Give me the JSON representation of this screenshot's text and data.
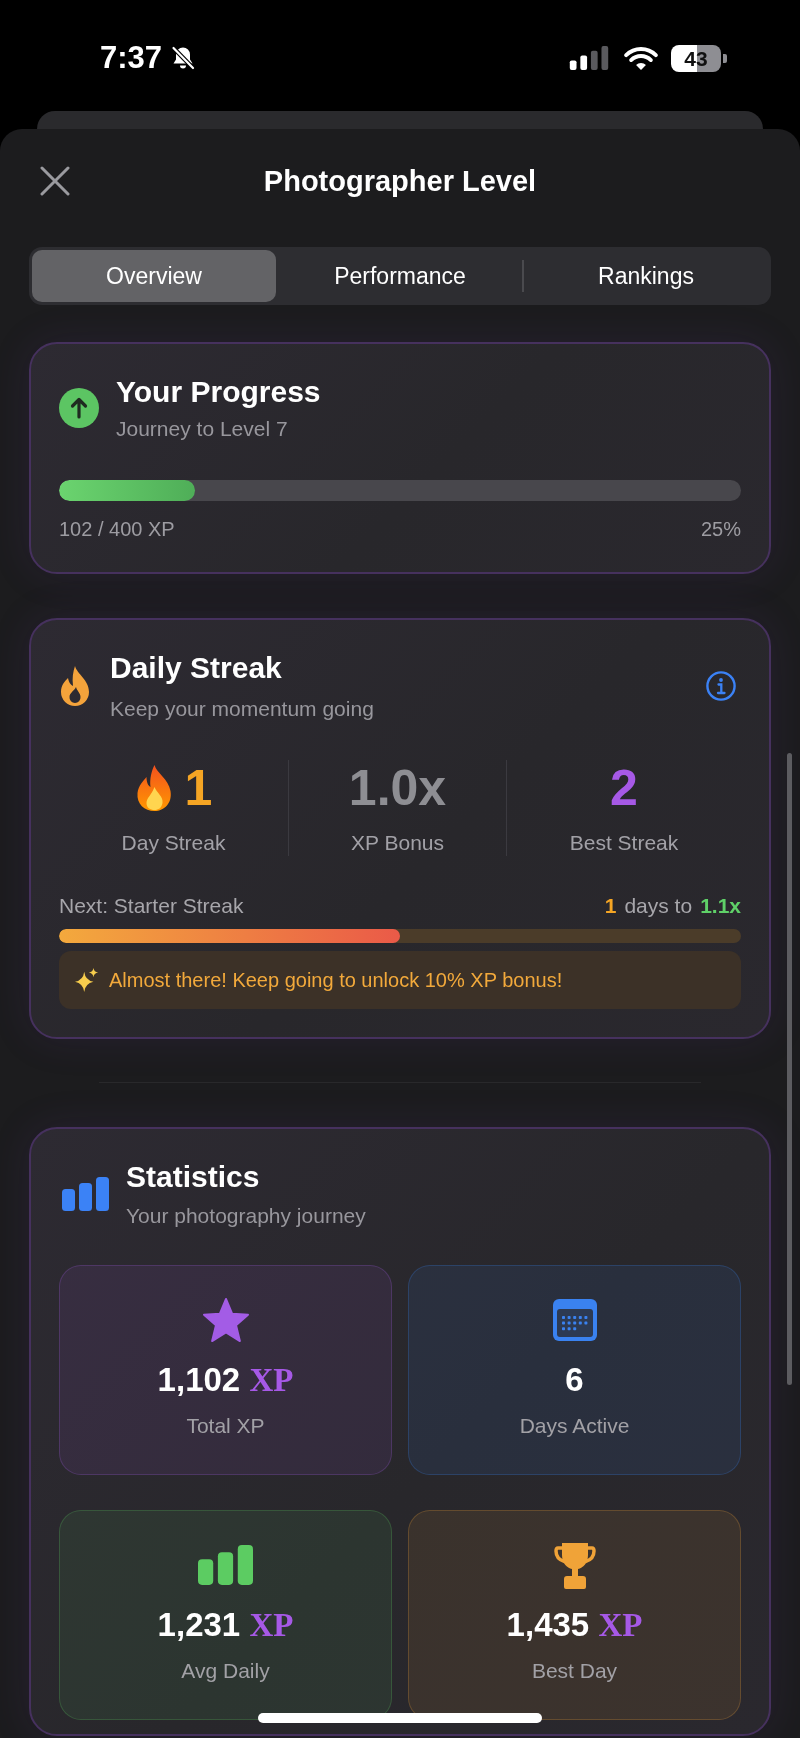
{
  "status_bar": {
    "time": "7:37",
    "battery": "43"
  },
  "header": {
    "title": "Photographer Level"
  },
  "tabs": [
    {
      "label": "Overview",
      "selected": true
    },
    {
      "label": "Performance",
      "selected": false
    },
    {
      "label": "Rankings",
      "selected": false
    }
  ],
  "progress": {
    "title": "Your Progress",
    "subtitle": "Journey to Level 7",
    "level": 0.2,
    "xp": "102 / 400 XP",
    "percent": "25%"
  },
  "streak": {
    "title": "Daily Streak",
    "subtitle": "Keep your momentum going",
    "stats": [
      {
        "value": "1",
        "label": "Day Streak",
        "color": "#f5a524"
      },
      {
        "value": "1.0x",
        "label": "XP Bonus",
        "color": "#8e8e93"
      },
      {
        "value": "2",
        "label": "Best Streak",
        "color": "#a659e6"
      }
    ],
    "next": "Next: Starter Streak",
    "days_left": "1",
    "days_text": "days to",
    "next_bonus": "1.1x",
    "level": 0.5,
    "message": "Almost there! Keep going to unlock 10% XP bonus!"
  },
  "statistics": {
    "title": "Statistics",
    "subtitle": "Your photography journey",
    "tiles": [
      {
        "value": "1,102",
        "unit": "XP",
        "label": "Total XP",
        "color": "#a35ce6"
      },
      {
        "value": "6",
        "label": "Days Active",
        "color": "#3a82f0"
      },
      {
        "value": "1,231",
        "unit": "XP",
        "label": "Avg Daily",
        "color": "#5ccc62"
      },
      {
        "value": "1,435",
        "unit": "XP",
        "label": "Best Day",
        "color": "#f0a338"
      }
    ]
  }
}
